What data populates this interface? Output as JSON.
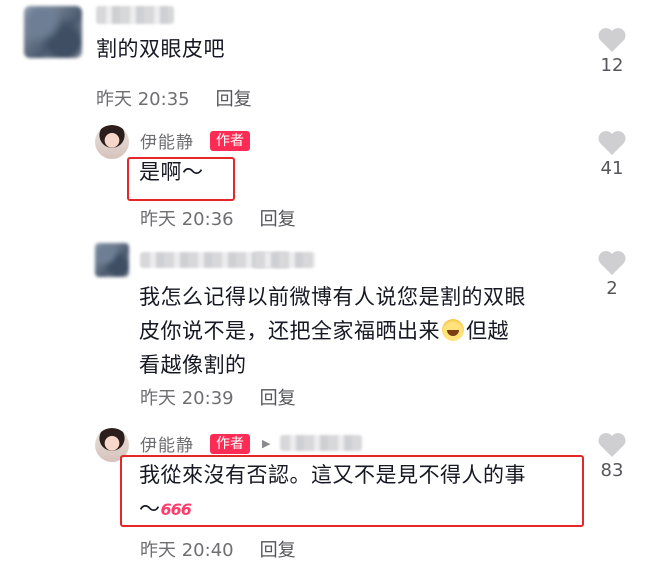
{
  "comments": [
    {
      "text": "割的双眼皮吧",
      "time": "昨天 20:35",
      "reply_label": "回复",
      "likes": "12"
    },
    {
      "name": "伊能静",
      "badge": "作者",
      "text": "是啊～",
      "time": "昨天 20:36",
      "reply_label": "回复",
      "likes": "41"
    },
    {
      "text_lines": [
        "我怎么记得以前微博有人说您是割的双眼",
        "皮你说不是，还把全家福晒出来",
        "但越",
        "看越像割的"
      ],
      "time": "昨天 20:39",
      "reply_label": "回复",
      "likes": "2"
    },
    {
      "name": "伊能静",
      "badge": "作者",
      "text_lines": [
        "我從來沒有否認。這又不是見不得人的事",
        "～"
      ],
      "time": "昨天 20:40",
      "reply_label": "回复",
      "likes": "83"
    }
  ],
  "icons": {
    "like": "heart-icon",
    "reply_target": "triangle-right-icon",
    "emoji": "laughing-crying-emoji-icon",
    "sticker": "666-sticker"
  },
  "sticker_text": "666",
  "colors": {
    "author_badge": "#fe2c55",
    "highlight_box": "#e5262b",
    "heart": "#cfcfd1"
  }
}
